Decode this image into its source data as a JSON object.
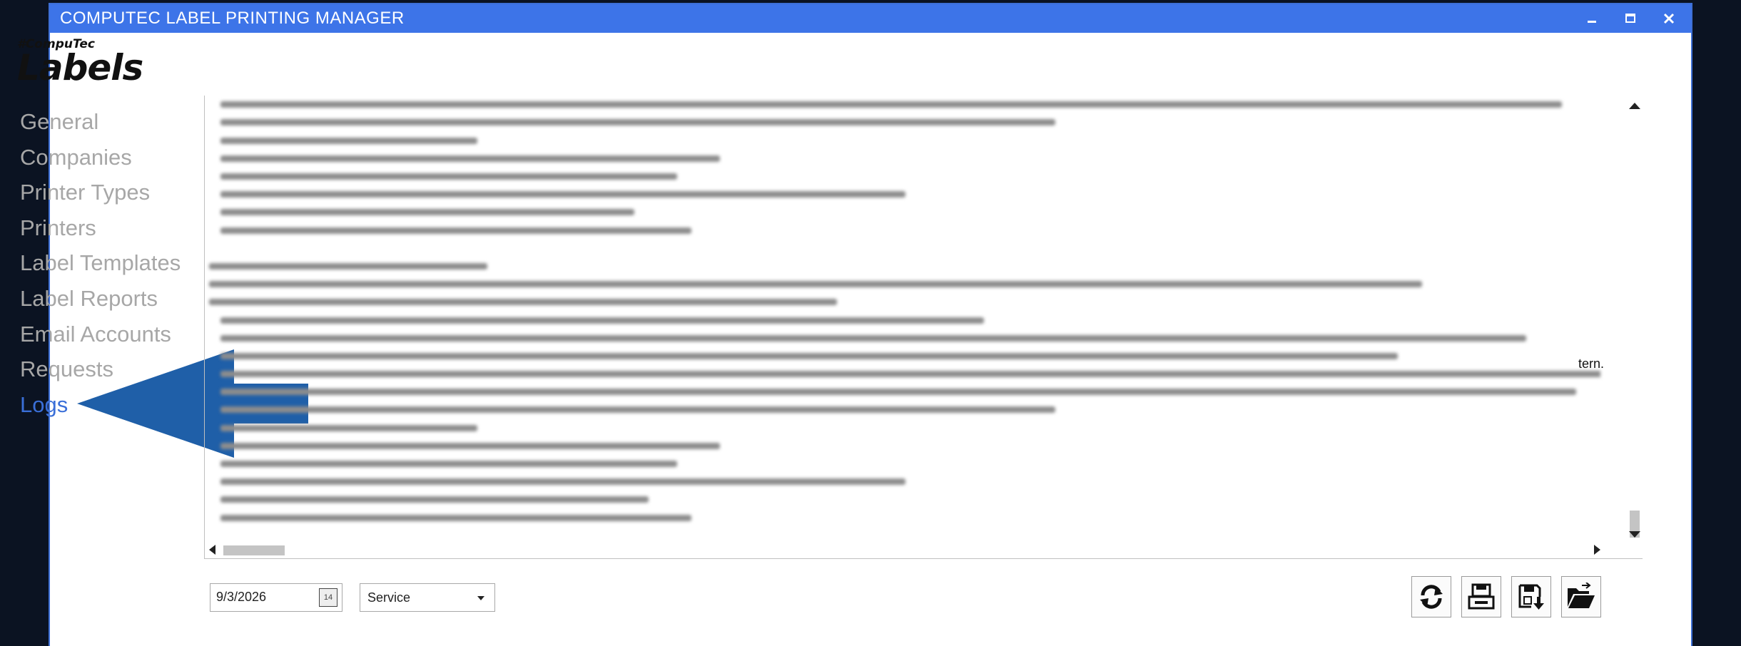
{
  "window": {
    "title": "COMPUTEC LABEL PRINTING MANAGER",
    "controls": [
      "minimize-icon",
      "maximize-icon",
      "close-icon"
    ],
    "accent_color": "#3d74e8"
  },
  "logo": {
    "line1": "#CompuTec",
    "line2": "Labels"
  },
  "nav": {
    "items": [
      {
        "label": "General",
        "active": false
      },
      {
        "label": "Companies",
        "active": false
      },
      {
        "label": "Printer Types",
        "active": false
      },
      {
        "label": "Printers",
        "active": false
      },
      {
        "label": "Label Templates",
        "active": false
      },
      {
        "label": "Label Reports",
        "active": false
      },
      {
        "label": "Email Accounts",
        "active": false
      },
      {
        "label": "Requests",
        "active": false
      },
      {
        "label": "Logs",
        "active": true
      }
    ],
    "active_color": "#3a6fd8",
    "inactive_color": "#a7a7a7"
  },
  "annotation": {
    "icon": "arrow-left-icon",
    "color": "#1f5fa8"
  },
  "log": {
    "visible_fragment": "tern."
  },
  "footer": {
    "date_value": "9/3/2026",
    "calendar_icon_text": "14",
    "log_source_selected": "Service",
    "buttons": [
      "refresh-icon",
      "save-all-icon",
      "save-icon",
      "open-folder-icon"
    ]
  }
}
